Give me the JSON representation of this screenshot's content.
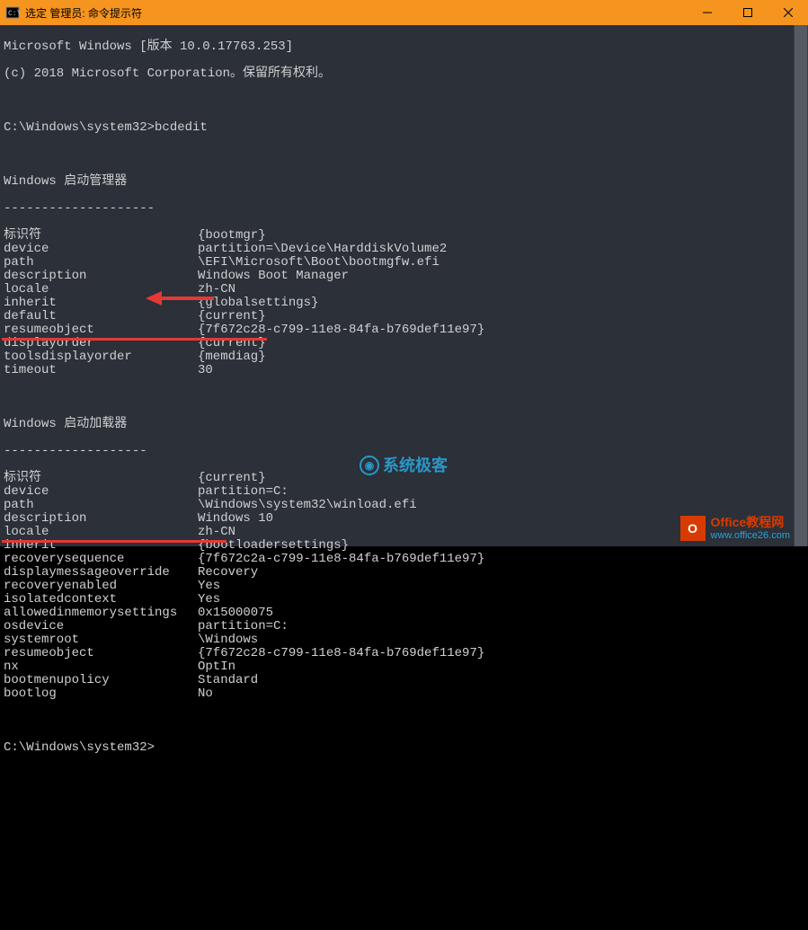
{
  "window": {
    "title": "选定 管理员: 命令提示符",
    "minimize": "—",
    "maximize": "□",
    "close": "✕"
  },
  "header": {
    "l1": "Microsoft Windows [版本 10.0.17763.253]",
    "l2": "(c) 2018 Microsoft Corporation。保留所有权利。"
  },
  "prompt1": "C:\\Windows\\system32>bcdedit",
  "section1": {
    "title": "Windows 启动管理器",
    "sep": "--------------------"
  },
  "bootmgr": [
    {
      "k": "标识符",
      "v": "{bootmgr}"
    },
    {
      "k": "device",
      "v": "partition=\\Device\\HarddiskVolume2"
    },
    {
      "k": "path",
      "v": "\\EFI\\Microsoft\\Boot\\bootmgfw.efi"
    },
    {
      "k": "description",
      "v": "Windows Boot Manager"
    },
    {
      "k": "locale",
      "v": "zh-CN"
    },
    {
      "k": "inherit",
      "v": "{globalsettings}"
    },
    {
      "k": "default",
      "v": "{current}"
    },
    {
      "k": "resumeobject",
      "v": "{7f672c28-c799-11e8-84fa-b769def11e97}"
    },
    {
      "k": "displayorder",
      "v": "{current}"
    },
    {
      "k": "toolsdisplayorder",
      "v": "{memdiag}"
    },
    {
      "k": "timeout",
      "v": "30"
    }
  ],
  "section2": {
    "title": "Windows 启动加载器",
    "sep": "-------------------"
  },
  "loader": [
    {
      "k": "标识符",
      "v": "{current}"
    },
    {
      "k": "device",
      "v": "partition=C:"
    },
    {
      "k": "path",
      "v": "\\Windows\\system32\\winload.efi"
    },
    {
      "k": "description",
      "v": "Windows 10"
    },
    {
      "k": "locale",
      "v": "zh-CN"
    },
    {
      "k": "inherit",
      "v": "{bootloadersettings}"
    },
    {
      "k": "recoverysequence",
      "v": "{7f672c2a-c799-11e8-84fa-b769def11e97}"
    },
    {
      "k": "displaymessageoverride",
      "v": "Recovery"
    },
    {
      "k": "recoveryenabled",
      "v": "Yes"
    },
    {
      "k": "isolatedcontext",
      "v": "Yes"
    },
    {
      "k": "allowedinmemorysettings",
      "v": "0x15000075"
    },
    {
      "k": "osdevice",
      "v": "partition=C:"
    },
    {
      "k": "systemroot",
      "v": "\\Windows"
    },
    {
      "k": "resumeobject",
      "v": "{7f672c28-c799-11e8-84fa-b769def11e97}"
    },
    {
      "k": "nx",
      "v": "OptIn"
    },
    {
      "k": "bootmenupolicy",
      "v": "Standard"
    },
    {
      "k": "bootlog",
      "v": "No"
    }
  ],
  "prompt2": "C:\\Windows\\system32>",
  "watermarks": {
    "w1": "系统极客",
    "w2a": "Office教程网",
    "w2b": "www.office26.com"
  }
}
